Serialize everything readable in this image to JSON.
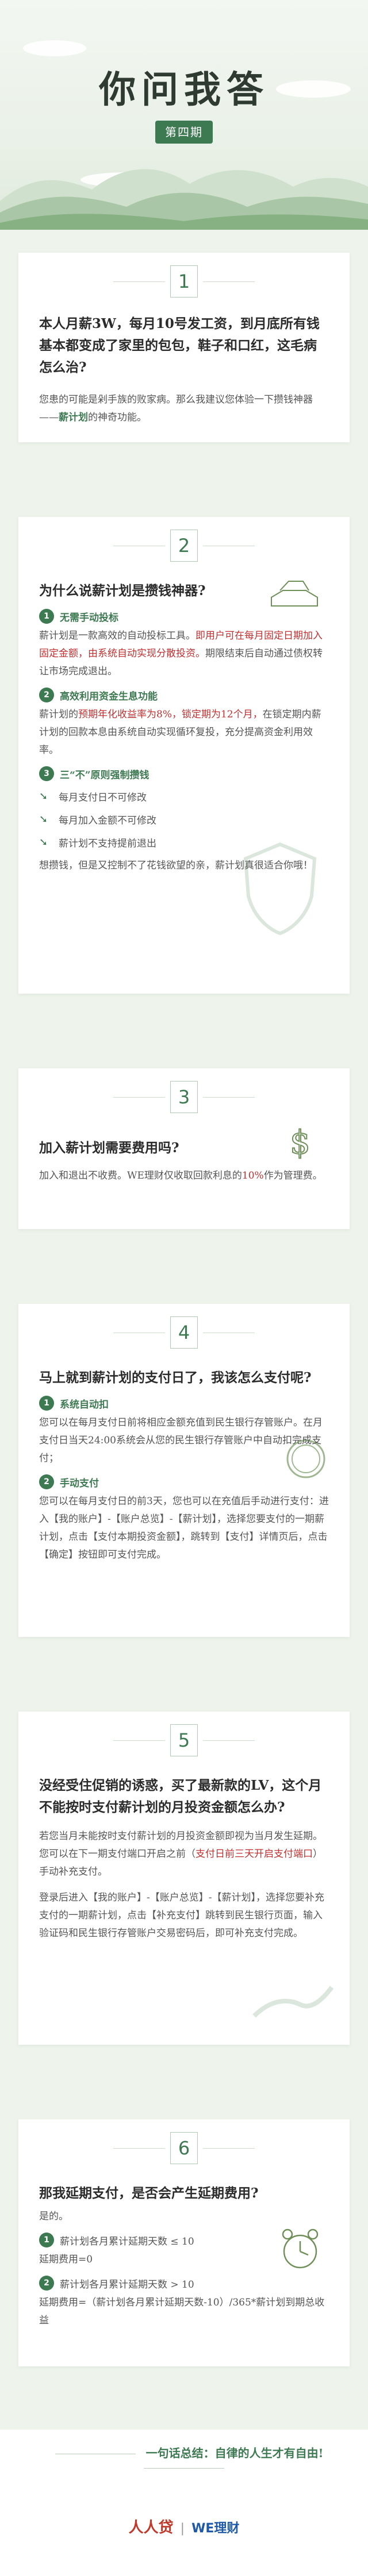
{
  "header": {
    "title": "你问我答",
    "issue": "第四期"
  },
  "q1": {
    "num": "1",
    "question": "本人月薪3W，每月10号发工资，到月底所有钱基本都变成了家里的包包，鞋子和口红，这毛病怎么治?",
    "answer_a": "您患的可能是剁手族的败家病。那么我建议您体验一下攒钱神器——",
    "answer_hl": "薪计划",
    "answer_b": "的神奇功能。"
  },
  "q2": {
    "num": "2",
    "question": "为什么说薪计划是攒钱神器?",
    "s1_num": "1",
    "s1_title": "无需手动投标",
    "s1_text_a": "薪计划是一款高效的自动投标工具。",
    "s1_text_hl": "即用户可在每月固定日期加入固定金额，由系统自动实现分散投资。",
    "s1_text_b": "期限结束后自动通过债权转让市场完成退出。",
    "s2_num": "2",
    "s2_title": "高效利用资金生息功能",
    "s2_text_a": "薪计划的",
    "s2_text_hl": "预期年化收益率为8%，锁定期为12个月，",
    "s2_text_b": "在锁定期内薪计划的回款本息由系统自动实现循环复投，充分提高资金利用效率。",
    "s3_num": "3",
    "s3_title": "三“不”原则强制攒钱",
    "rules": [
      "每月支付日不可修改",
      "每月加入金额不可修改",
      "薪计划不支持提前退出"
    ],
    "closing": "想攒钱，但是又控制不了花钱欲望的亲，薪计划真很适合你哦！"
  },
  "q3": {
    "num": "3",
    "question": "加入薪计划需要费用吗?",
    "answer_a": "加入和退出不收费。WE理财仅收取回款利息的",
    "answer_hl": "10%",
    "answer_b": "作为管理费。"
  },
  "q4": {
    "num": "4",
    "question": "马上就到薪计划的支付日了，我该怎么支付呢?",
    "s1_num": "1",
    "s1_title": "系统自动扣",
    "s1_text": "您可以在每月支付日前将相应金额充值到民生银行存管账户。在月支付日当天24:00系统会从您的民生银行存管账户中自动扣完成支付；",
    "s2_num": "2",
    "s2_title": "手动支付",
    "s2_text": "您可以在每月支付日的前3天，您也可以在充值后手动进行支付：进入【我的账户】-【账户总览】-【薪计划】，选择您要支付的一期薪计划，点击【支付本期投资金额】，跳转到【支付】详情页后，点击【确定】按钮即可支付完成。"
  },
  "q5": {
    "num": "5",
    "question": "没经受住促销的诱惑，买了最新款的LV，这个月不能按时支付薪计划的月投资金额怎么办?",
    "answer_1a": "若您当月未能按时支付薪计划的月投资金额即视为当月发生延期。您可以在下一期支付端口开启之前（",
    "answer_1hl": "支付日前三天开启支付端口",
    "answer_1b": "）手动补充支付。",
    "answer_2": "登录后进入【我的账户】-【账户总览】-【薪计划】，选择您要补充支付的一期薪计划，点击【补充支付】跳转到民生银行页面，输入验证码和民生银行存管账户交易密码后，即可补充支付完成。"
  },
  "q6": {
    "num": "6",
    "question": "那我延期支付，是否会产生延期费用?",
    "intro": "是的。",
    "s1_num": "1",
    "s1_title": "薪计划各月累计延期天数 ≤ 10",
    "s1_text": "延期费用=0",
    "s2_num": "2",
    "s2_title": "薪计划各月累计延期天数 > 10",
    "s2_text": "延期费用=（薪计划各月累计延期天数-10）/365*薪计划到期总收益"
  },
  "footer": {
    "slogan": "一句话总结：自律的人生才有自由!",
    "brand1": "人人贷",
    "brand2": "WE理财"
  }
}
